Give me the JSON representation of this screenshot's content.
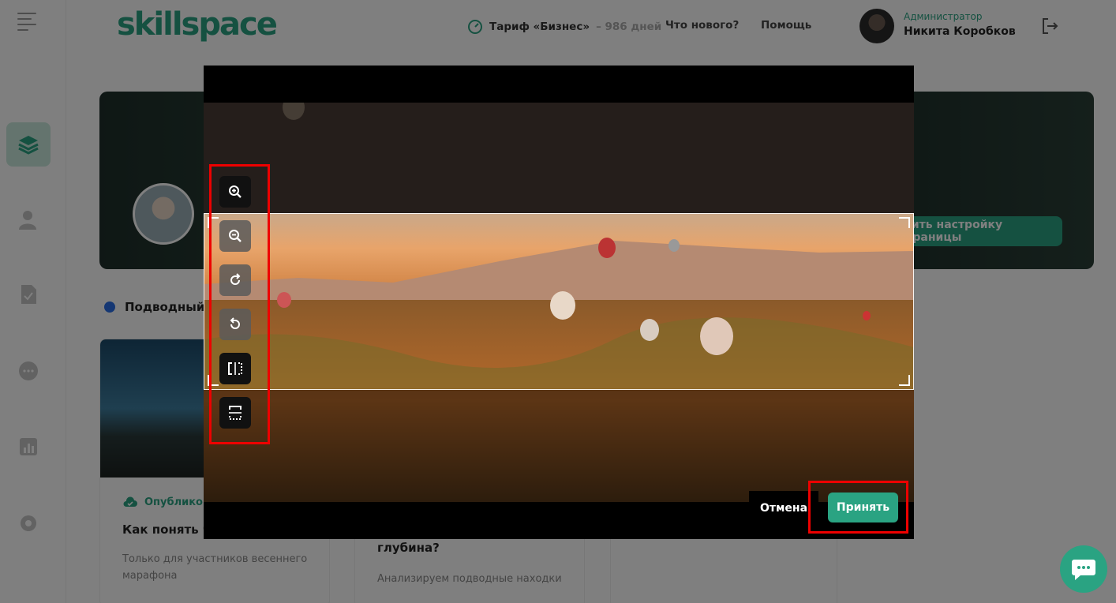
{
  "header": {
    "logo": "skillspace",
    "tariff_label": "Тариф «Бизнес»",
    "tariff_days": "– 986 дней",
    "nav": [
      "Что нового?",
      "Помощь"
    ],
    "user_role": "Администратор",
    "user_name": "Никита Коробков"
  },
  "sidebar": {
    "items": [
      "courses-icon",
      "users-icon",
      "tasks-icon",
      "chat-icon",
      "reports-icon",
      "settings-icon"
    ]
  },
  "banner": {
    "button_label": "шить настройку страницы"
  },
  "section": {
    "title": "Подводный"
  },
  "cards": [
    {
      "status": "Опубликов",
      "title": "Как понять че",
      "desc_1": "Только для участников весеннего",
      "desc_2": "марафона"
    },
    {
      "title": "глубина?",
      "desc": "Анализируем подводные находки"
    }
  ],
  "cropper": {
    "tools": [
      "zoom-in-icon",
      "zoom-out-icon",
      "rotate-right-icon",
      "rotate-left-icon",
      "flip-horizontal-icon",
      "flip-vertical-icon"
    ],
    "cancel_label": "Отмена",
    "accept_label": "Принять"
  },
  "colors": {
    "accent": "#2aa382",
    "highlight": "#e00000"
  }
}
